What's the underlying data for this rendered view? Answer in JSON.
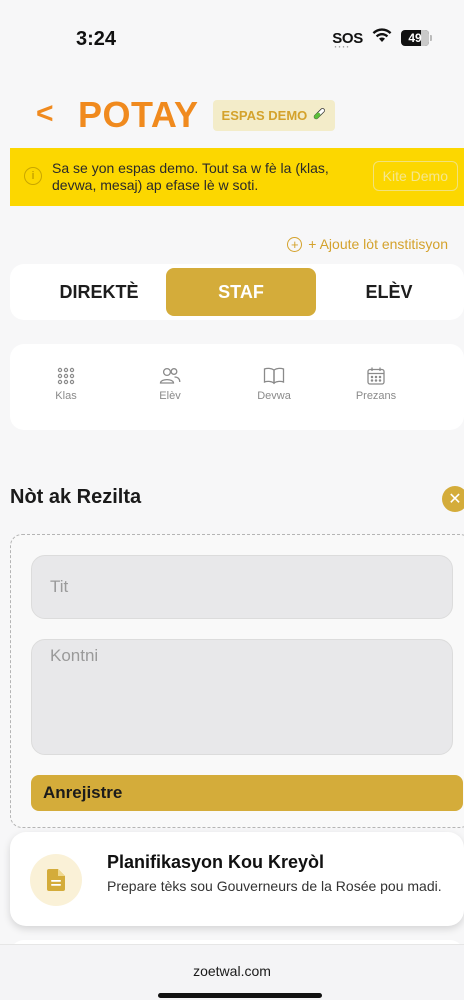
{
  "status_bar": {
    "time": "3:24",
    "sos": "SOS",
    "battery": "49"
  },
  "header": {
    "back": "<",
    "title": "POTAY",
    "demo_badge": "ESPAS DEMO",
    "demo_badge_icon": "test-tube-icon"
  },
  "banner": {
    "text": "Sa se yon espas demo. Tout sa w fè la (klas, devwa, mesaj) ap efase lè w soti.",
    "exit_label": "Kite Demo"
  },
  "add_institution": {
    "label": "+ Ajoute lòt enstitisyon"
  },
  "role_tabs": [
    {
      "label": "DIREKTÈ",
      "active": false
    },
    {
      "label": "STAF",
      "active": true
    },
    {
      "label": "ELÈV",
      "active": false
    }
  ],
  "nav": [
    {
      "label": "Klas",
      "icon": "grid-icon"
    },
    {
      "label": "Elèv",
      "icon": "users-icon"
    },
    {
      "label": "Devwa",
      "icon": "book-icon"
    },
    {
      "label": "Prezans",
      "icon": "calendar-icon"
    }
  ],
  "form": {
    "title": "Nòt ak Rezilta",
    "title_placeholder": "Tit",
    "content_placeholder": "Kontni",
    "save_label": "Anrejistre"
  },
  "note": {
    "title": "Planifikasyon Kou Kreyòl",
    "description": "Prepare tèks sou Gouverneurs de la Rosée pou madi.",
    "icon": "document-icon"
  },
  "browser": {
    "url": "zoetwal.com"
  },
  "colors": {
    "accent": "#f08a1e",
    "gold": "#d4ac3a",
    "banner": "#fcd700"
  }
}
